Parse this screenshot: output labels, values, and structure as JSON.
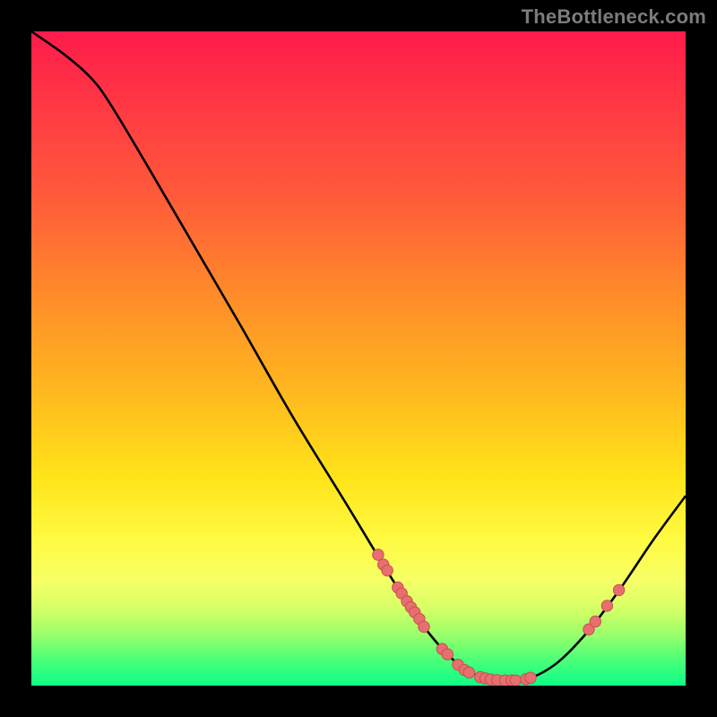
{
  "watermark": "TheBottleneck.com",
  "colors": {
    "curve": "#000000",
    "point_fill": "#e76f6f",
    "point_stroke": "#c94f50",
    "gradient_top": "#ff1a4b",
    "gradient_bottom": "#0cff86",
    "frame": "#000000"
  },
  "chart_data": {
    "type": "line",
    "title": "",
    "xlabel": "",
    "ylabel": "",
    "xlim": [
      0,
      100
    ],
    "ylim": [
      0,
      100
    ],
    "note": "Axes are not labeled in the image; values are relative (0–100) estimated from pixel positions. y=0 is the bottom of the plot.",
    "curve": [
      {
        "x": 0,
        "y": 100
      },
      {
        "x": 5,
        "y": 96.5
      },
      {
        "x": 9,
        "y": 93
      },
      {
        "x": 12,
        "y": 89
      },
      {
        "x": 18,
        "y": 79
      },
      {
        "x": 25,
        "y": 67
      },
      {
        "x": 32,
        "y": 55
      },
      {
        "x": 40,
        "y": 41
      },
      {
        "x": 48,
        "y": 28
      },
      {
        "x": 55,
        "y": 16.5
      },
      {
        "x": 60,
        "y": 9
      },
      {
        "x": 65,
        "y": 3.5
      },
      {
        "x": 70,
        "y": 0.9
      },
      {
        "x": 75,
        "y": 0.8
      },
      {
        "x": 80,
        "y": 3.2
      },
      {
        "x": 85,
        "y": 8.2
      },
      {
        "x": 90,
        "y": 14.8
      },
      {
        "x": 95,
        "y": 22.2
      },
      {
        "x": 100,
        "y": 29
      }
    ],
    "series": [
      {
        "name": "highlighted-points",
        "kind": "scatter",
        "points": [
          {
            "x": 53.0,
            "y": 20.0
          },
          {
            "x": 53.8,
            "y": 18.5
          },
          {
            "x": 54.4,
            "y": 17.6
          },
          {
            "x": 56.0,
            "y": 15.0
          },
          {
            "x": 56.6,
            "y": 14.1
          },
          {
            "x": 57.4,
            "y": 12.9
          },
          {
            "x": 58.0,
            "y": 12.0
          },
          {
            "x": 58.6,
            "y": 11.2
          },
          {
            "x": 59.3,
            "y": 10.2
          },
          {
            "x": 60.0,
            "y": 9.0
          },
          {
            "x": 62.8,
            "y": 5.6
          },
          {
            "x": 63.6,
            "y": 4.8
          },
          {
            "x": 65.2,
            "y": 3.2
          },
          {
            "x": 66.2,
            "y": 2.4
          },
          {
            "x": 66.9,
            "y": 2.0
          },
          {
            "x": 68.6,
            "y": 1.3
          },
          {
            "x": 69.4,
            "y": 1.1
          },
          {
            "x": 70.2,
            "y": 0.95
          },
          {
            "x": 71.2,
            "y": 0.85
          },
          {
            "x": 72.4,
            "y": 0.8
          },
          {
            "x": 73.4,
            "y": 0.8
          },
          {
            "x": 74.0,
            "y": 0.8
          },
          {
            "x": 75.6,
            "y": 1.0
          },
          {
            "x": 76.3,
            "y": 1.2
          },
          {
            "x": 85.2,
            "y": 8.6
          },
          {
            "x": 86.2,
            "y": 9.8
          },
          {
            "x": 88.0,
            "y": 12.2
          },
          {
            "x": 89.8,
            "y": 14.6
          }
        ]
      }
    ]
  }
}
